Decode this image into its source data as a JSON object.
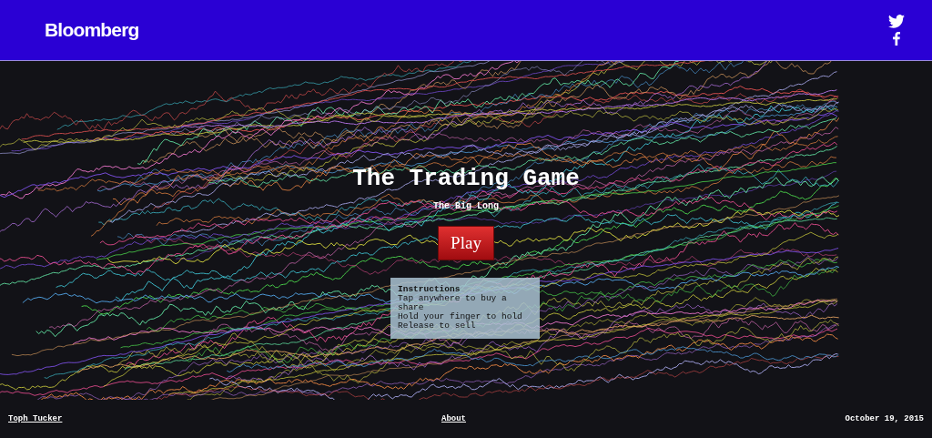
{
  "header": {
    "logo": "Bloomberg"
  },
  "game": {
    "title": "The Trading Game",
    "subtitle": "The Big Long",
    "play_button": "Play",
    "instructions": {
      "heading": "Instructions",
      "lines": [
        "Tap anywhere to buy a share",
        "Hold your finger to hold",
        "Release to sell"
      ]
    }
  },
  "footer": {
    "author": "Toph Tucker",
    "about": "About",
    "date": "October 19, 2015"
  }
}
